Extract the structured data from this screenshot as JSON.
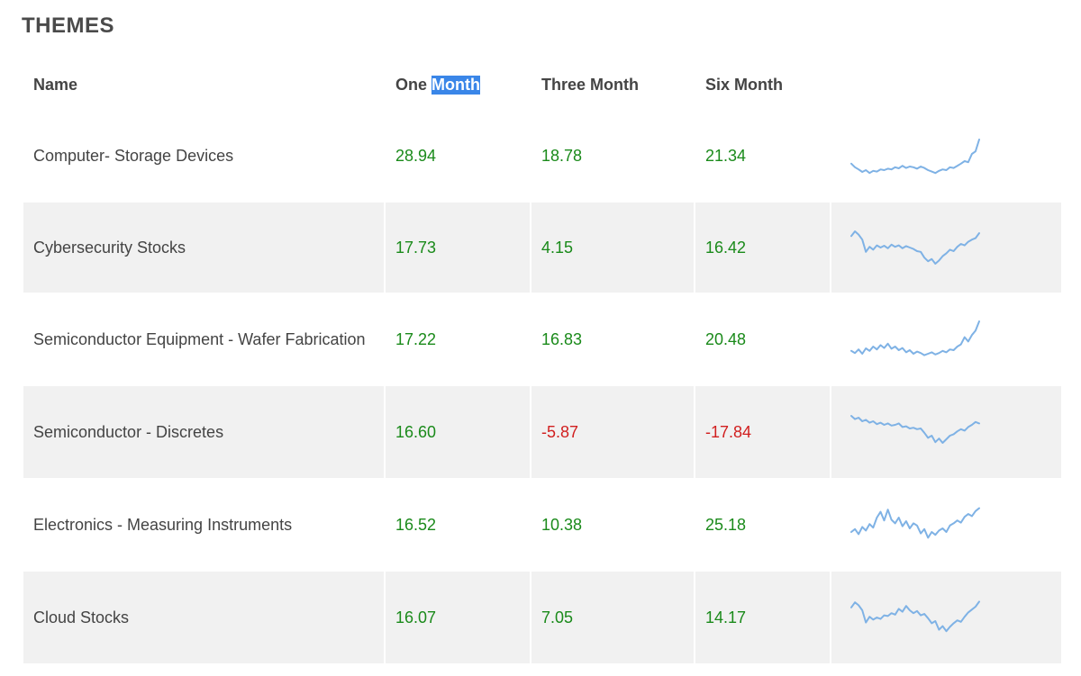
{
  "page": {
    "title": "THEMES"
  },
  "columns": {
    "name": "Name",
    "one_month_part1": "One",
    "one_month_part2": "Month",
    "three_month": "Three Month",
    "six_month": "Six Month"
  },
  "colors": {
    "positive": "#1a8a1a",
    "negative": "#d11f1f",
    "sparkline": "#7fb2e5",
    "row_shade": "#f1f1f1",
    "selection": "#3a86e8"
  },
  "rows": [
    {
      "name": "Computer- Storage Devices",
      "one": "28.94",
      "three": "18.78",
      "six": "21.34",
      "spark": [
        0.28,
        0.18,
        0.12,
        0.05,
        0.1,
        0.02,
        0.08,
        0.06,
        0.12,
        0.1,
        0.14,
        0.12,
        0.18,
        0.15,
        0.22,
        0.16,
        0.2,
        0.18,
        0.14,
        0.2,
        0.16,
        0.1,
        0.06,
        0.02,
        0.08,
        0.12,
        0.1,
        0.18,
        0.16,
        0.22,
        0.28,
        0.35,
        0.32,
        0.55,
        0.62,
        0.95
      ]
    },
    {
      "name": "Cybersecurity Stocks",
      "one": "17.73",
      "three": "4.15",
      "six": "16.42",
      "spark": [
        0.82,
        0.95,
        0.86,
        0.72,
        0.38,
        0.52,
        0.44,
        0.56,
        0.5,
        0.55,
        0.48,
        0.58,
        0.52,
        0.56,
        0.48,
        0.54,
        0.5,
        0.46,
        0.4,
        0.38,
        0.22,
        0.12,
        0.18,
        0.05,
        0.14,
        0.26,
        0.34,
        0.44,
        0.4,
        0.52,
        0.6,
        0.56,
        0.66,
        0.72,
        0.76,
        0.9
      ]
    },
    {
      "name": "Semiconductor Equipment - Wafer Fabrication",
      "one": "17.22",
      "three": "16.83",
      "six": "20.48",
      "spark": [
        0.18,
        0.12,
        0.22,
        0.1,
        0.25,
        0.18,
        0.3,
        0.22,
        0.34,
        0.26,
        0.38,
        0.24,
        0.3,
        0.2,
        0.26,
        0.14,
        0.2,
        0.1,
        0.16,
        0.12,
        0.06,
        0.1,
        0.14,
        0.08,
        0.12,
        0.18,
        0.14,
        0.22,
        0.2,
        0.3,
        0.36,
        0.56,
        0.44,
        0.62,
        0.74,
        1.0
      ]
    },
    {
      "name": "Semiconductor - Discretes",
      "one": "16.60",
      "three": "-5.87",
      "six": "-17.84",
      "spark": [
        0.95,
        0.86,
        0.9,
        0.8,
        0.84,
        0.76,
        0.8,
        0.72,
        0.76,
        0.7,
        0.74,
        0.68,
        0.7,
        0.74,
        0.64,
        0.66,
        0.6,
        0.62,
        0.58,
        0.6,
        0.48,
        0.34,
        0.4,
        0.22,
        0.32,
        0.2,
        0.3,
        0.4,
        0.44,
        0.52,
        0.58,
        0.54,
        0.64,
        0.7,
        0.78,
        0.74
      ]
    },
    {
      "name": "Electronics - Measuring Instruments",
      "one": "16.52",
      "three": "10.38",
      "six": "25.18",
      "spark": [
        0.3,
        0.38,
        0.24,
        0.44,
        0.34,
        0.52,
        0.42,
        0.7,
        0.86,
        0.62,
        0.92,
        0.64,
        0.54,
        0.7,
        0.46,
        0.6,
        0.4,
        0.54,
        0.48,
        0.26,
        0.38,
        0.14,
        0.3,
        0.22,
        0.34,
        0.4,
        0.3,
        0.48,
        0.54,
        0.62,
        0.56,
        0.72,
        0.8,
        0.74,
        0.88,
        0.96
      ]
    },
    {
      "name": "Cloud Stocks",
      "one": "16.07",
      "three": "7.05",
      "six": "14.17",
      "spark": [
        0.78,
        0.92,
        0.84,
        0.7,
        0.36,
        0.52,
        0.44,
        0.5,
        0.46,
        0.56,
        0.54,
        0.62,
        0.58,
        0.74,
        0.66,
        0.82,
        0.7,
        0.62,
        0.68,
        0.56,
        0.6,
        0.48,
        0.34,
        0.4,
        0.16,
        0.26,
        0.12,
        0.24,
        0.34,
        0.42,
        0.38,
        0.52,
        0.64,
        0.72,
        0.8,
        0.94
      ]
    }
  ]
}
